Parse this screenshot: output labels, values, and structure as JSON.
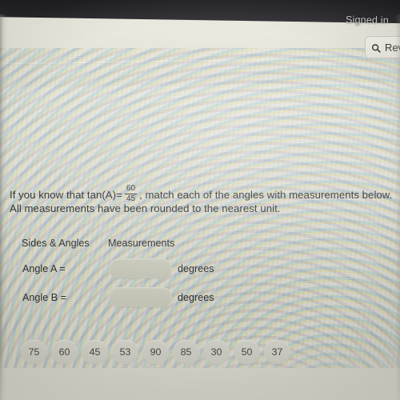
{
  "topbar": {
    "signed_in_text": "Signed in",
    "background_color": "#1d1c20"
  },
  "header": {
    "search_button": {
      "label": "Rev",
      "icon": "search-icon"
    }
  },
  "question": {
    "line1_before": "If you know that tan(A)=",
    "fraction_numerator": "60",
    "fraction_denominator": "45",
    "line1_after": ", match each of the angles with measurements below.",
    "line2": "All measurements have been rounded to the nearest unit."
  },
  "table": {
    "headers": {
      "sides_angles": "Sides & Angles",
      "measurements": "Measurements"
    },
    "rows": [
      {
        "label": "Angle A =",
        "value": "",
        "unit": "degrees"
      },
      {
        "label": "Angle B =",
        "value": "",
        "unit": "degrees"
      }
    ]
  },
  "answer_bank": {
    "options": [
      "75",
      "60",
      "45",
      "53",
      "90",
      "85",
      "30",
      "50",
      "37"
    ]
  },
  "colors": {
    "page_background": "#e4e2d8",
    "topbar": "#1d1c20",
    "chip_fill": "#c6c6bc",
    "dropzone_fill": "#c3c4b6",
    "text": "#2a2a2a"
  }
}
